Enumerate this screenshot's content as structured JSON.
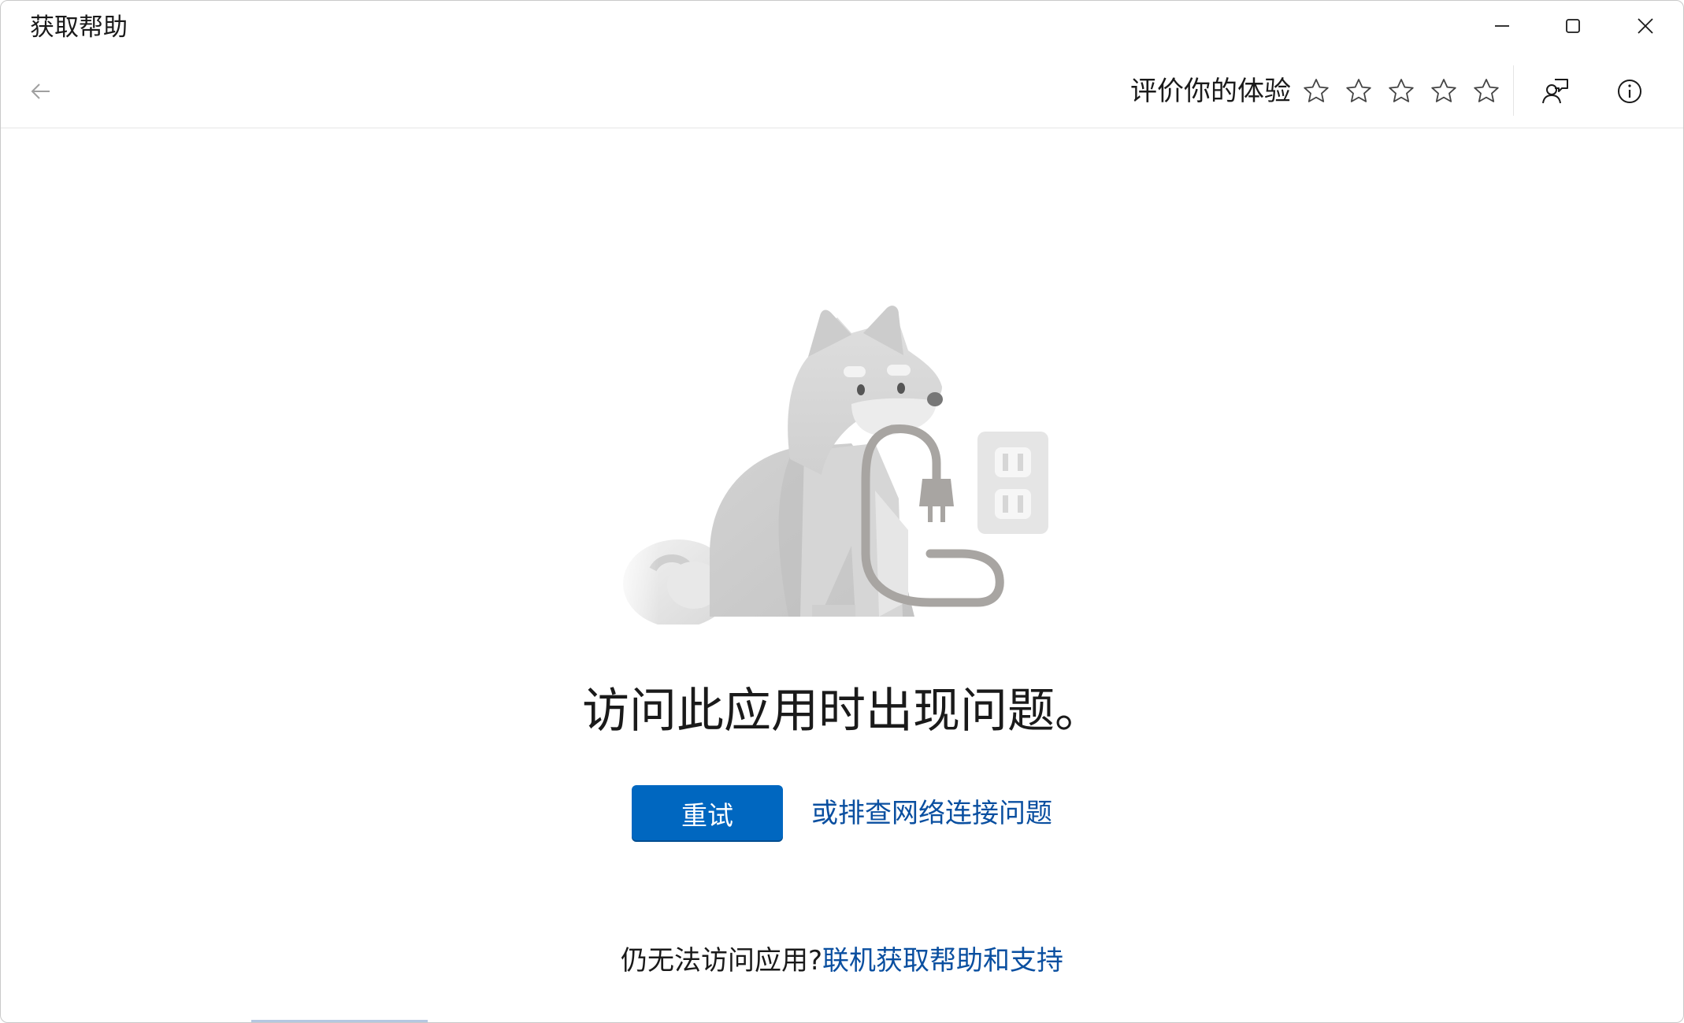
{
  "window": {
    "title": "获取帮助",
    "controls": {
      "minimize_icon": "minimize-icon",
      "maximize_icon": "maximize-icon",
      "close_icon": "close-icon"
    }
  },
  "toolbar": {
    "back_icon": "back-arrow-icon",
    "rate_label": "评价你的体验",
    "star_count": 5,
    "rating_value": 0,
    "feedback_icon": "feedback-icon",
    "info_icon": "info-icon"
  },
  "main": {
    "illustration": "dog-with-unplugged-cord",
    "heading": "访问此应用时出现问题。",
    "retry_label": "重试",
    "troubleshoot_link": "或排查网络连接问题",
    "footer_text": "仍无法访问应用?",
    "footer_link": "联机获取帮助和支持"
  },
  "colors": {
    "accent": "#0067c0",
    "link": "#0a4fa0",
    "text": "#1a1a1a",
    "dog_light": "#e3e3e3",
    "dog_mid": "#c9c9c9",
    "cord": "#a8a5a2"
  }
}
